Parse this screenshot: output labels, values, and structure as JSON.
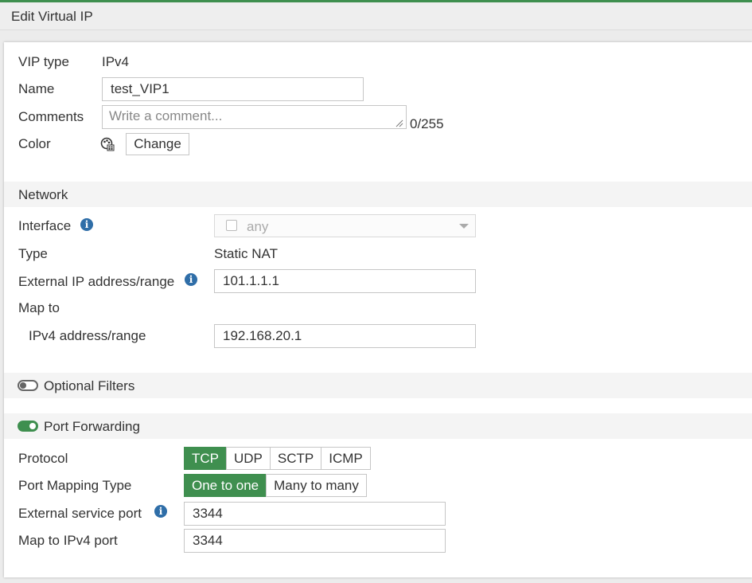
{
  "header": {
    "title": "Edit Virtual IP"
  },
  "general": {
    "vip_type_label": "VIP type",
    "vip_type_value": "IPv4",
    "name_label": "Name",
    "name_value": "test_VIP1",
    "comments_label": "Comments",
    "comments_placeholder": "Write a comment...",
    "comments_counter": "0/255",
    "color_label": "Color",
    "change_button": "Change"
  },
  "network": {
    "section_title": "Network",
    "interface_label": "Interface",
    "interface_value": "any",
    "type_label": "Type",
    "type_value": "Static NAT",
    "external_ip_label": "External IP address/range",
    "external_ip_value": "101.1.1.1",
    "map_to_label": "Map to",
    "ipv4_range_label": "IPv4 address/range",
    "ipv4_range_value": "192.168.20.1"
  },
  "optional_filters": {
    "label": "Optional Filters",
    "enabled": false
  },
  "port_forwarding": {
    "label": "Port Forwarding",
    "enabled": true,
    "protocol_label": "Protocol",
    "protocols": [
      "TCP",
      "UDP",
      "SCTP",
      "ICMP"
    ],
    "protocol_selected": "TCP",
    "mapping_type_label": "Port Mapping Type",
    "mapping_types": [
      "One to one",
      "Many to many"
    ],
    "mapping_type_selected": "One to one",
    "external_port_label": "External service port",
    "external_port_value": "3344",
    "map_port_label": "Map to IPv4 port",
    "map_port_value": "3344"
  },
  "colors": {
    "accent": "#3f8f4f",
    "info": "#2f6ea8"
  }
}
